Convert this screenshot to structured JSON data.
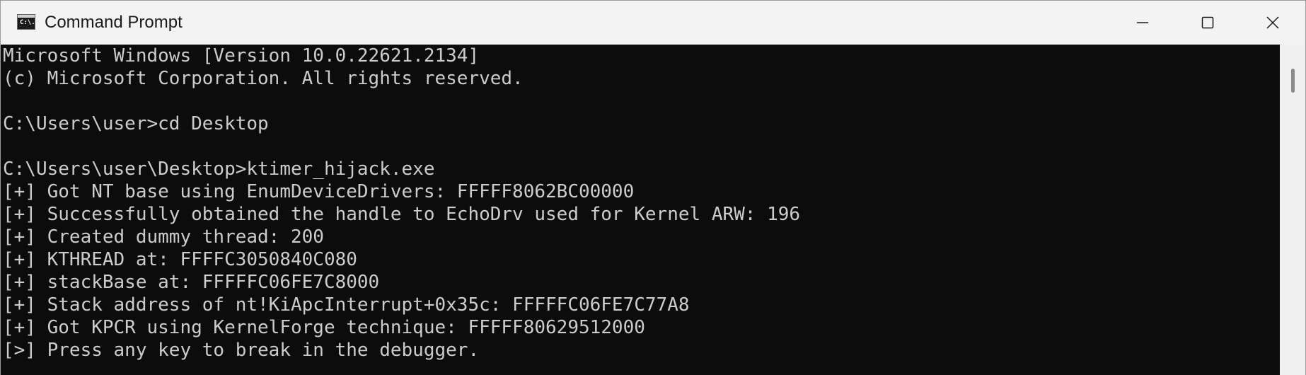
{
  "window": {
    "title": "Command Prompt",
    "icon_text": "C:\\."
  },
  "controls": {
    "minimize": "minimize-icon",
    "maximize": "maximize-icon",
    "close": "close-icon"
  },
  "console": {
    "lines": [
      "Microsoft Windows [Version 10.0.22621.2134]",
      "(c) Microsoft Corporation. All rights reserved.",
      "",
      "C:\\Users\\user>cd Desktop",
      "",
      "C:\\Users\\user\\Desktop>ktimer_hijack.exe",
      "[+] Got NT base using EnumDeviceDrivers: FFFFF8062BC00000",
      "[+] Successfully obtained the handle to EchoDrv used for Kernel ARW: 196",
      "[+] Created dummy thread: 200",
      "[+] KTHREAD at: FFFFC3050840C080",
      "[+] stackBase at: FFFFFC06FE7C8000",
      "[+] Stack address of nt!KiApcInterrupt+0x35c: FFFFFC06FE7C77A8",
      "[+] Got KPCR using KernelForge technique: FFFFF80629512000",
      "[>] Press any key to break in the debugger."
    ]
  },
  "colors": {
    "console_bg": "#0c0c0c",
    "console_fg": "#cccccc",
    "titlebar_bg": "#f3f3f3"
  }
}
